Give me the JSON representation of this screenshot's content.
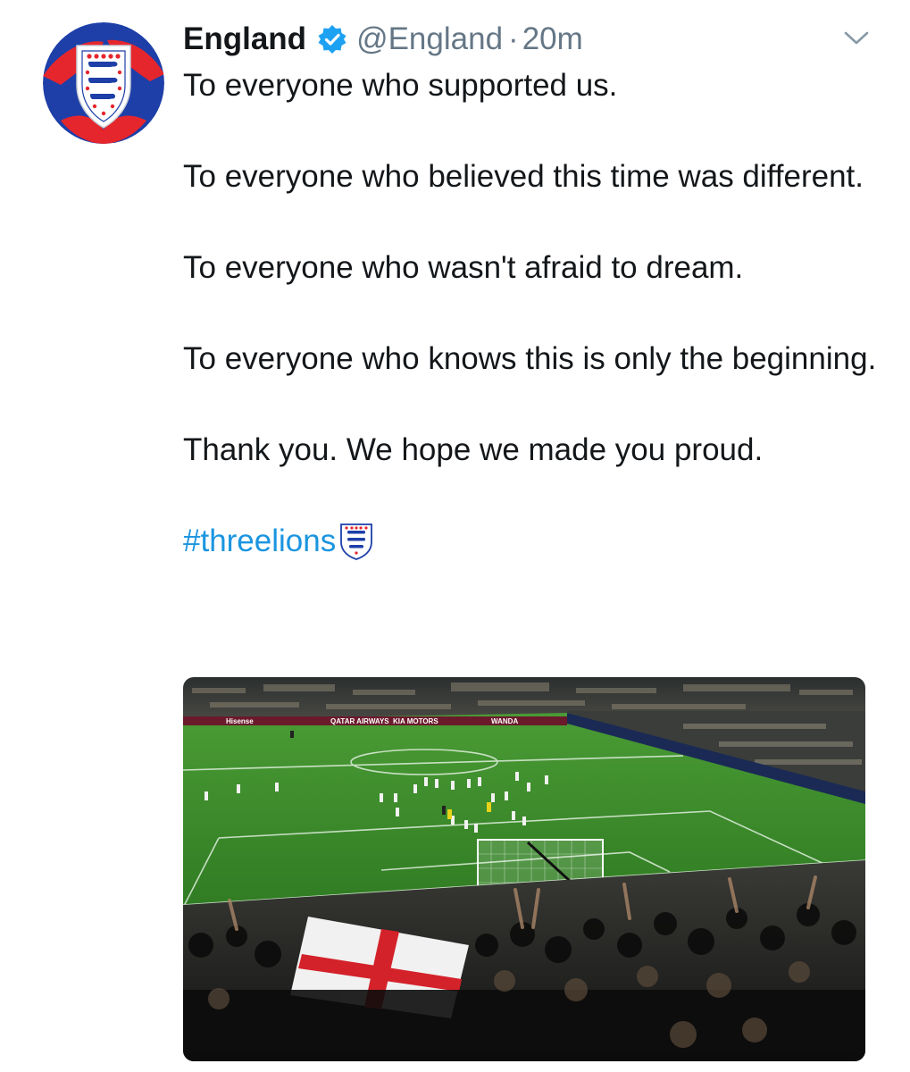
{
  "tweet": {
    "display_name": "England",
    "handle": "@England",
    "separator": "·",
    "time": "20m",
    "paragraphs": [
      "To everyone who supported us.",
      "To everyone who believed this time was different.",
      "To everyone who wasn't afraid to dream.",
      "To everyone who knows this is only the beginning.",
      "Thank you. We hope we made you proud."
    ],
    "hashtag": "#threelions",
    "media_banner_1": "QATAR AIRWAYS",
    "media_banner_2": "KIA MOTORS",
    "media_banner_3": "WANDA",
    "media_banner_4": "Hisense"
  },
  "colors": {
    "accent": "#1b95e0",
    "text": "#14171a",
    "secondary": "#657786",
    "verified": "#1da1f2",
    "avatar_blue": "#1e3fa8",
    "avatar_red": "#e5262d",
    "pitch_green": "#3f8f2c"
  },
  "icons": {
    "verified": "verified-badge-icon",
    "chevron": "chevron-down-icon",
    "crest": "three-lions-crest-icon"
  }
}
